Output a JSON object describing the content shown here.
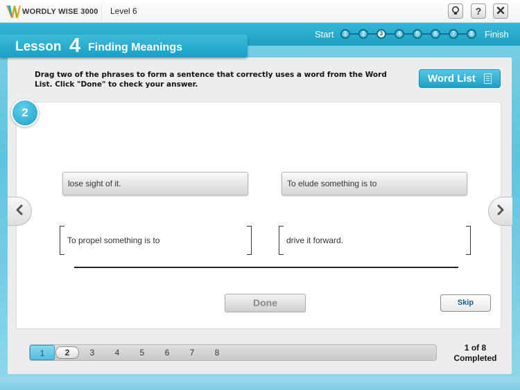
{
  "app": {
    "logo_text": "WORDLY WISE 3000",
    "level": "Level 6"
  },
  "header": {
    "start_label": "Start",
    "finish_label": "Finish",
    "steps": [
      "1",
      "2",
      "3",
      "4",
      "5",
      "6",
      "7",
      "8"
    ],
    "current_step": "3"
  },
  "lesson": {
    "word": "Lesson",
    "number": "4",
    "title": "Finding Meanings"
  },
  "instructions": "Drag two of the phrases to form a sentence that correctly uses a word from the Word List. Click \"Done\" to check your answer.",
  "word_list_label": "Word List",
  "question": {
    "number": "2",
    "choices": [
      "lose sight of it.",
      "To elude something is to"
    ],
    "slots": [
      "To propel something is to",
      "drive it forward."
    ]
  },
  "buttons": {
    "done": "Done",
    "skip": "Skip"
  },
  "pager": {
    "pages": [
      "1",
      "2",
      "3",
      "4",
      "5",
      "6",
      "7",
      "8"
    ],
    "current_page": "2",
    "progress_line1": "1 of 8",
    "progress_line2": "Completed"
  },
  "colors": {
    "accent": "#1ea0c4",
    "band": "#34b6d6",
    "panel": "#ededed"
  }
}
